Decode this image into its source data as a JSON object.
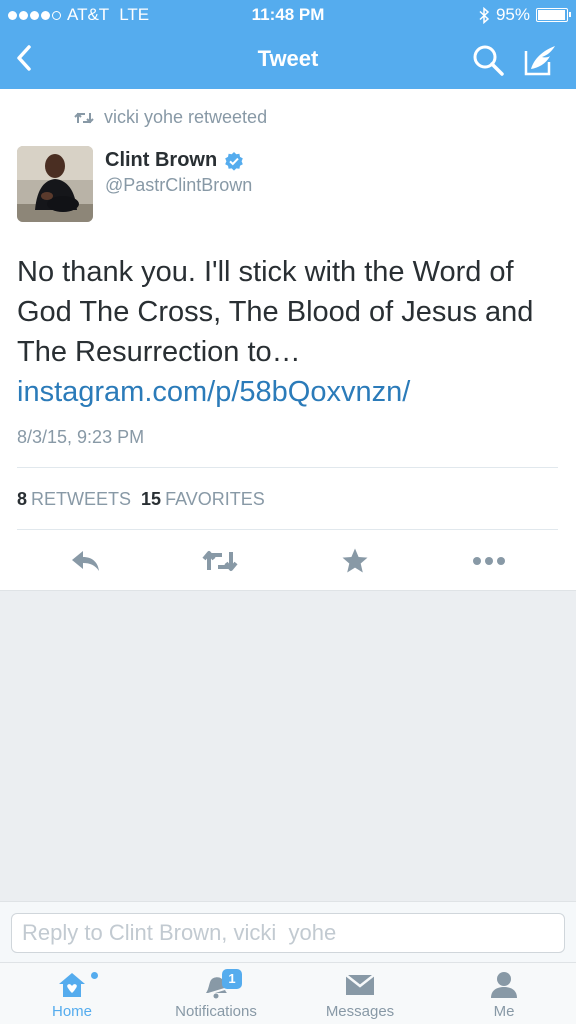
{
  "status_bar": {
    "carrier": "AT&T",
    "network": "LTE",
    "time": "11:48 PM",
    "battery_percent": "95%",
    "battery_level": 0.95
  },
  "nav": {
    "title": "Tweet",
    "icons": [
      "back-chevron-icon",
      "search-icon",
      "compose-icon"
    ]
  },
  "tweet": {
    "retweeted_by": "vicki  yohe retweeted",
    "author_name": "Clint Brown",
    "author_handle": "@PastrClintBrown",
    "verified": true,
    "text": "No thank you.  I'll stick with the Word of God The Cross, The Blood of Jesus and The Resurrection to… ",
    "link": "instagram.com/p/58bQoxvnzn/",
    "timestamp": "8/3/15, 9:23 PM",
    "retweets_count": "8",
    "retweets_label": "RETWEETS",
    "favorites_count": "15",
    "favorites_label": "FAVORITES",
    "actions": [
      "reply-icon",
      "retweet-icon",
      "favorite-icon",
      "more-icon"
    ]
  },
  "reply": {
    "placeholder": "Reply to Clint Brown, vicki  yohe"
  },
  "tabs": [
    {
      "label": "Home",
      "icon": "home-icon",
      "active": true
    },
    {
      "label": "Notifications",
      "icon": "notifications-icon",
      "badge": "1"
    },
    {
      "label": "Messages",
      "icon": "messages-icon"
    },
    {
      "label": "Me",
      "icon": "person-icon"
    }
  ],
  "colors": {
    "brand": "#55acee",
    "link": "#2b7bb9",
    "muted": "#8899a6",
    "text": "#292f33"
  }
}
